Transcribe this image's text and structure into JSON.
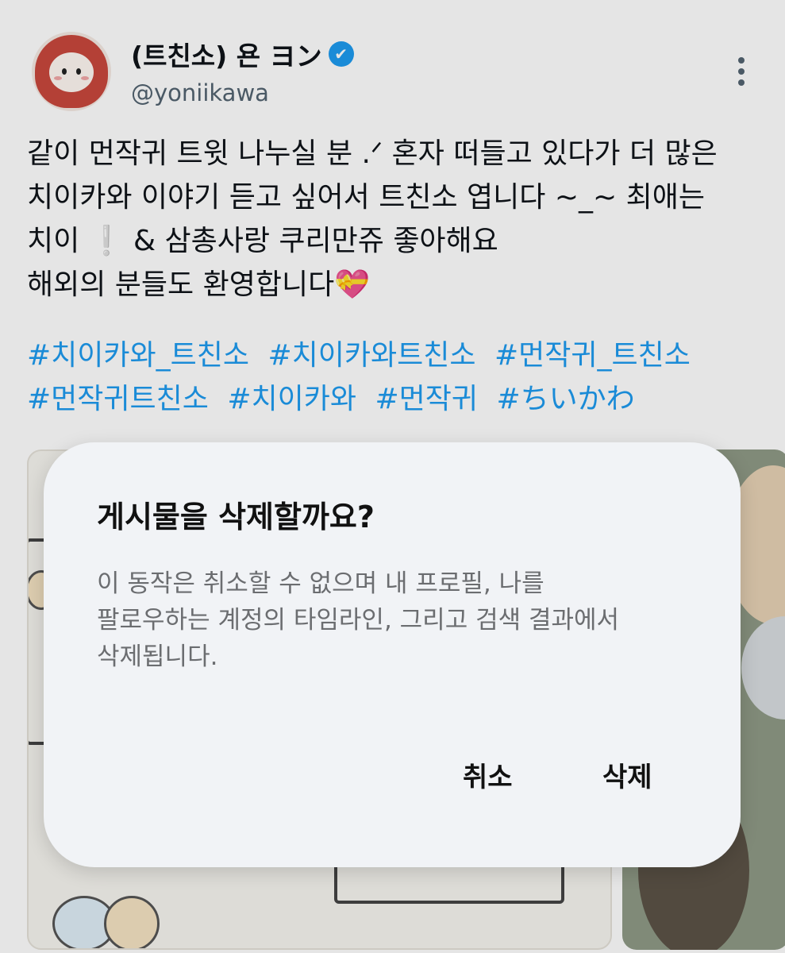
{
  "tweet": {
    "display_name": "(트친소) 욘 ヨン",
    "verified_mark": "✔",
    "handle": "@yoniikawa",
    "text_lines": [
      "같이 먼작귀 트윗 나누실 분 .ᐟ 혼자 떠들고 있다가 더 많은",
      "치이카와 이야기 듣고 싶어서 트친소 엽니다 ~_~  최애는",
      "치이 ❕ & 삼총사랑 쿠리만쥬 좋아해요",
      "해외의 분들도 환영합니다💝"
    ],
    "hashtags": [
      "#치이카와_트친소",
      "#치이카와트친소",
      "#먼작귀_트친소",
      "#먼작귀트친소",
      "#치이카와",
      "#먼작귀",
      "#ちいかわ"
    ]
  },
  "dialog": {
    "title": "게시물을 삭제할까요?",
    "body_lines": [
      "이 동작은 취소할 수 없으며 내 프로필, 나를",
      "팔로우하는 계정의 타임라인, 그리고 검색 결과에서",
      "삭제됩니다."
    ],
    "cancel_label": "취소",
    "delete_label": "삭제"
  },
  "colors": {
    "link": "#1d9bf0",
    "dialog_bg": "#f1f3f6",
    "muted_text": "#6b6d70"
  }
}
